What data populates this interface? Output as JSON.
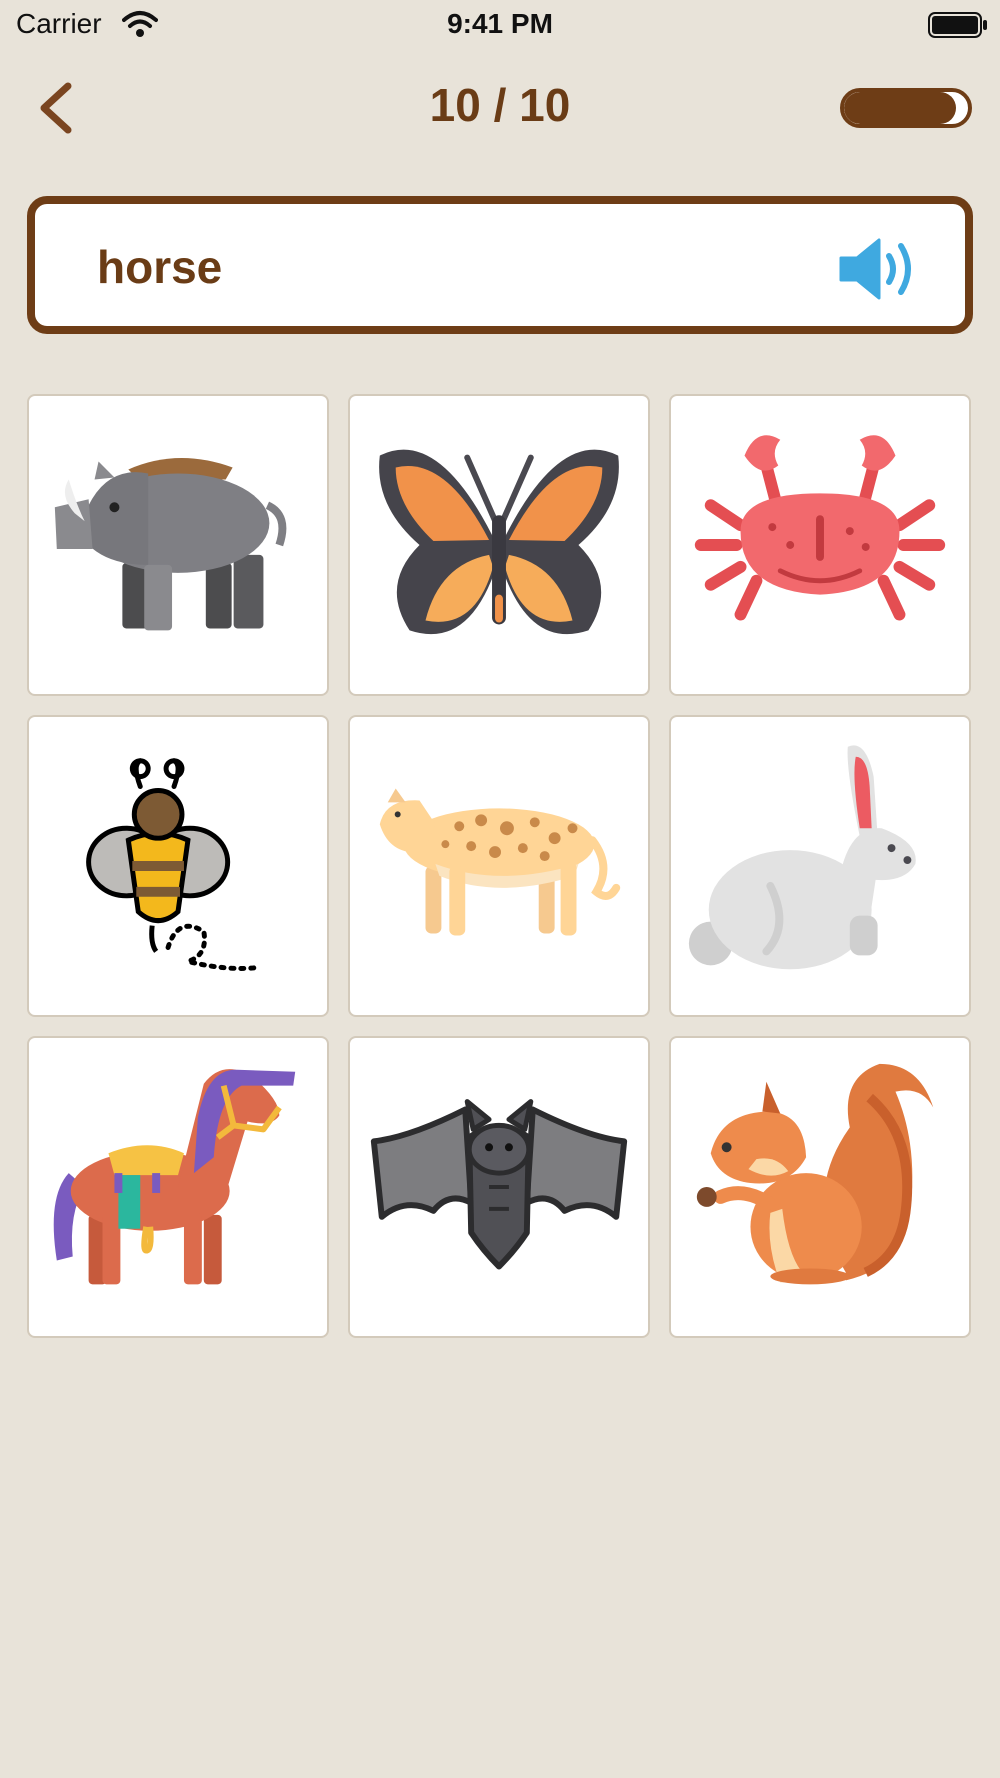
{
  "status_bar": {
    "carrier": "Carrier",
    "time": "9:41 PM"
  },
  "header": {
    "progress_label": "10 / 10",
    "progress_fraction": 0.9
  },
  "prompt": {
    "word": "horse"
  },
  "answers": [
    {
      "icon": "boar-icon"
    },
    {
      "icon": "butterfly-icon"
    },
    {
      "icon": "crab-icon"
    },
    {
      "icon": "bee-icon"
    },
    {
      "icon": "leopard-icon"
    },
    {
      "icon": "rabbit-icon"
    },
    {
      "icon": "horse-icon"
    },
    {
      "icon": "bat-icon"
    },
    {
      "icon": "squirrel-icon"
    }
  ],
  "colors": {
    "background": "#e8e3d9",
    "brown_accent": "#6e3d16",
    "speaker_blue": "#3fa9e0",
    "tile_border": "#d3cabb"
  }
}
